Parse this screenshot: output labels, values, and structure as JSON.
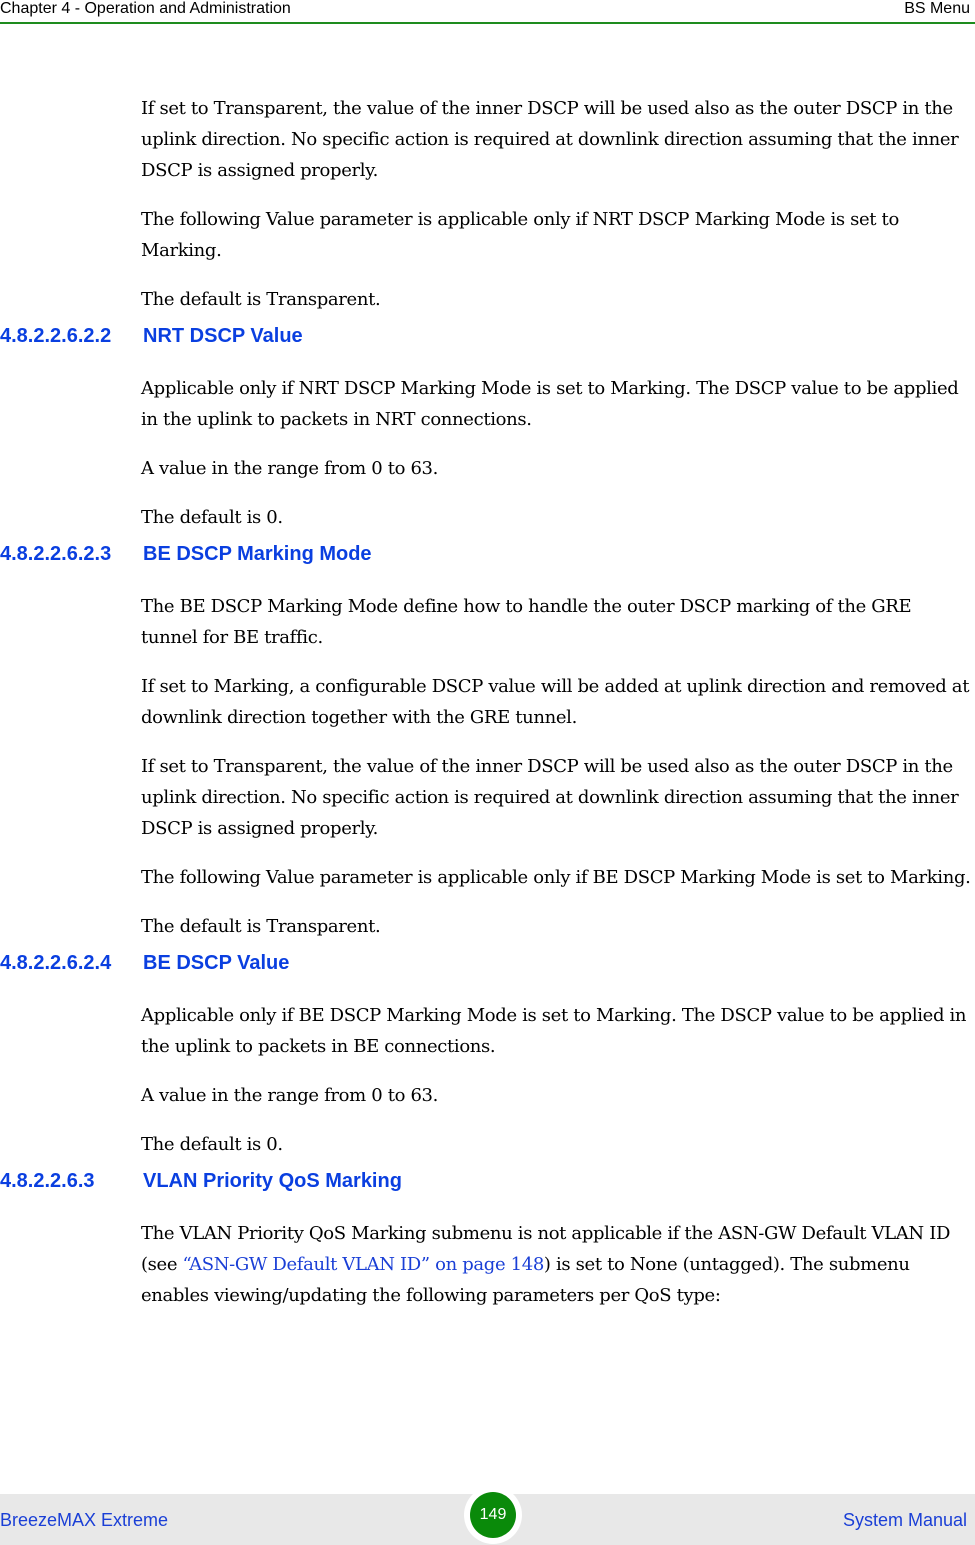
{
  "header": {
    "chapter": "Chapter 4 - Operation and Administration",
    "section": "BS Menu"
  },
  "body": {
    "p1": "If set to Transparent, the value of the inner DSCP will be used also as the outer DSCP in the uplink direction. No specific action is required at downlink direction assuming that the inner DSCP is assigned properly.",
    "p2": "The following Value parameter is applicable only if NRT DSCP Marking Mode is set to Marking.",
    "p3": "The default is Transparent.",
    "s1": {
      "number": "4.8.2.2.6.2.2",
      "title": "NRT DSCP Value",
      "p1": "Applicable only if NRT DSCP Marking Mode is set to Marking. The DSCP value to be applied in the uplink to packets in NRT connections.",
      "p2": "A value in the range from 0 to 63.",
      "p3": "The default is 0."
    },
    "s2": {
      "number": "4.8.2.2.6.2.3",
      "title": "BE DSCP Marking Mode",
      "p1": "The BE DSCP Marking Mode define how to handle the outer DSCP marking of the GRE tunnel for BE traffic.",
      "p2": "If set to Marking, a configurable DSCP value will be added at uplink direction and removed at downlink direction together with the GRE tunnel.",
      "p3": "If set to Transparent, the value of the inner DSCP will be used also as the outer DSCP in the uplink direction. No specific action is required at downlink direction assuming that the inner DSCP is assigned properly.",
      "p4": "The following Value parameter is applicable only if BE DSCP Marking Mode is set to Marking.",
      "p5": "The default is Transparent."
    },
    "s3": {
      "number": "4.8.2.2.6.2.4",
      "title": "BE DSCP Value",
      "p1": "Applicable only if BE DSCP Marking Mode is set to Marking. The DSCP value to be applied in the uplink to packets in BE connections.",
      "p2": "A value in the range from 0 to 63.",
      "p3": "The default is 0."
    },
    "s4": {
      "number": "4.8.2.2.6.3",
      "title": "VLAN Priority QoS Marking",
      "p1_before": "The VLAN Priority QoS Marking submenu is not applicable if the ASN-GW Default VLAN ID (see ",
      "p1_link": "“ASN-GW Default VLAN ID” on page 148",
      "p1_after": ") is set to None (untagged). The submenu enables viewing/updating the following parameters per QoS type:"
    }
  },
  "footer": {
    "product": "BreezeMAX Extreme",
    "page": "149",
    "doc": "System Manual"
  }
}
